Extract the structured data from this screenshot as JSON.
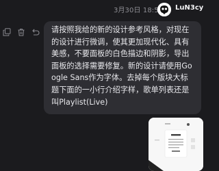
{
  "header": {
    "timestamp": "3月30日 18:51",
    "username": "LuN3cy"
  },
  "message": {
    "text": "请按照我给的新的设计参考风格，对现在的设计进行微调，使其更加现代化、具有美感，不要面板的白色描边和阴影，导出面板的选择需要修复。新的设计请使用Google Sans作为字体。去掉每个版块大标题下面的一小行介绍字样，歌单列表还是叫Playlist(Live)"
  },
  "actions": {
    "icons": [
      "copy-icon",
      "trash-icon",
      "undo-icon"
    ]
  },
  "attachment": {
    "kind": "screenshot-thumbnail"
  },
  "colors": {
    "background": "#1b1b1e",
    "bubble": "#2e2e33",
    "text": "#e8e8ec",
    "muted": "#8d8d93"
  }
}
